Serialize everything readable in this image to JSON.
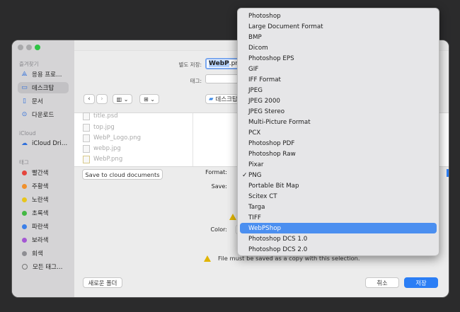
{
  "sidebar": {
    "favorites_header": "즐겨찾기",
    "favorites": [
      {
        "label": "응용 프로…",
        "icon": "applications-icon"
      },
      {
        "label": "데스크탑",
        "icon": "desktop-icon",
        "selected": true
      },
      {
        "label": "문서",
        "icon": "document-icon"
      },
      {
        "label": "다운로드",
        "icon": "download-icon"
      }
    ],
    "icloud_header": "iCloud",
    "icloud": [
      {
        "label": "iCloud Dri…",
        "icon": "cloud-icon"
      }
    ],
    "tags_header": "태그",
    "tags": [
      {
        "label": "빨간색",
        "color": "#e5453d"
      },
      {
        "label": "주황색",
        "color": "#f0902c"
      },
      {
        "label": "노란색",
        "color": "#e8c51b"
      },
      {
        "label": "초록색",
        "color": "#43b843"
      },
      {
        "label": "파란색",
        "color": "#3b7fe8"
      },
      {
        "label": "보라색",
        "color": "#a457d3"
      },
      {
        "label": "회색",
        "color": "#8e8e93"
      },
      {
        "label": "모든 태그…",
        "color": ""
      }
    ]
  },
  "save": {
    "save_as_label": "별도 저장:",
    "filename_bold": "WebP",
    "filename_rest": ".png",
    "tags_label": "태그:"
  },
  "toolbar": {
    "back": "‹",
    "forward": "›",
    "location": "데스크탑"
  },
  "files": [
    "title.psd",
    "top.jpg",
    "WebP_Logo.png",
    "webp.jpg",
    "WebP.png"
  ],
  "buttons": {
    "cloud": "Save to cloud documents",
    "new_folder": "새로운 폴더",
    "cancel": "취소",
    "save": "저장"
  },
  "options": {
    "format_label": "Format:",
    "save_label": "Save:",
    "color_label": "Color:",
    "warning": "File must be saved as a copy with this selection."
  },
  "format_menu": {
    "items": [
      "Photoshop",
      "Large Document Format",
      "BMP",
      "Dicom",
      "Photoshop EPS",
      "GIF",
      "IFF Format",
      "JPEG",
      "JPEG 2000",
      "JPEG Stereo",
      "Multi-Picture Format",
      "PCX",
      "Photoshop PDF",
      "Photoshop Raw",
      "Pixar",
      "PNG",
      "Portable Bit Map",
      "Scitex CT",
      "Targa",
      "TIFF",
      "WebPShop",
      "Photoshop DCS 1.0",
      "Photoshop DCS 2.0"
    ],
    "checked": "PNG",
    "highlighted": "WebPShop",
    "accent": "#4b8ff0"
  }
}
